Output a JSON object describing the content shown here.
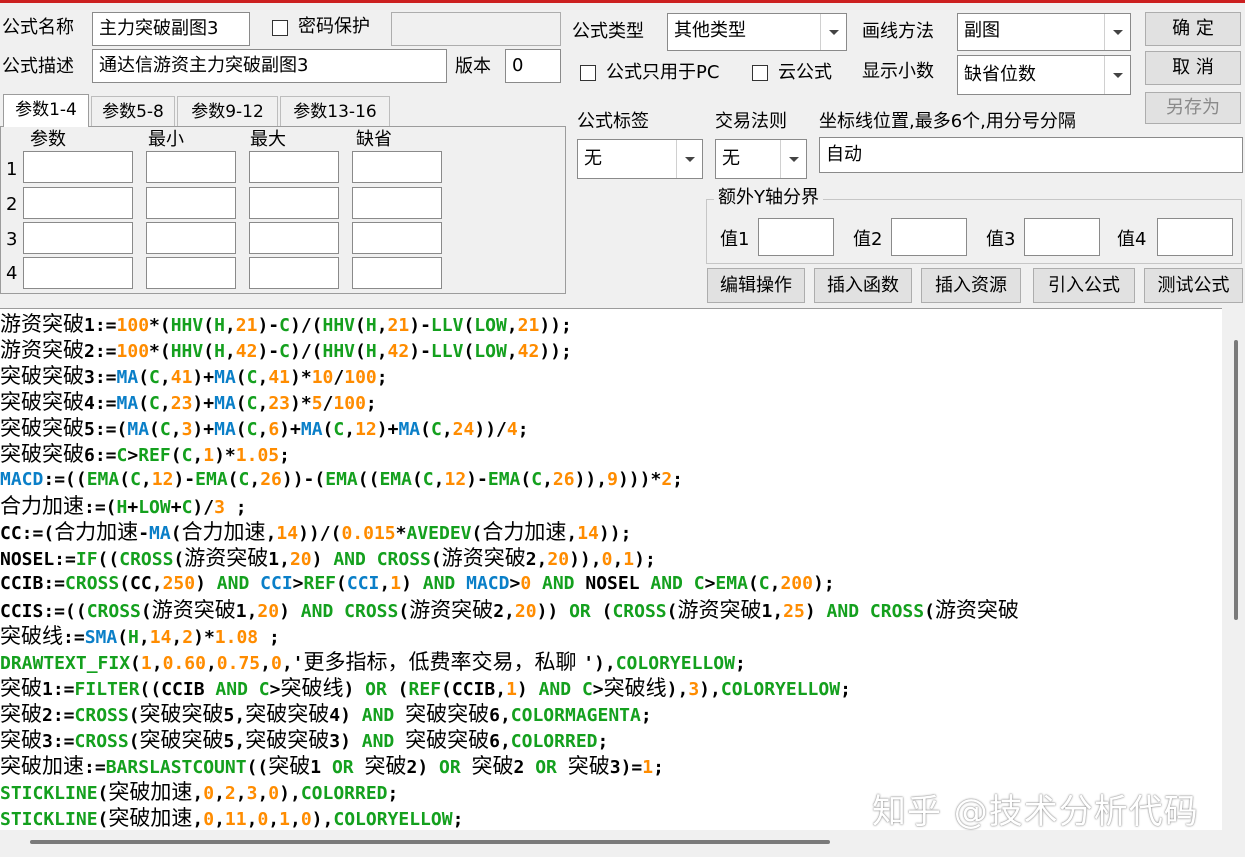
{
  "form": {
    "name_label": "公式名称",
    "name_value": "主力突破副图3",
    "password_label": "密码保护",
    "desc_label": "公式描述",
    "desc_value": "通达信游资主力突破副图3",
    "version_label": "版本",
    "version_value": "0",
    "type_label": "公式类型",
    "type_value": "其他类型",
    "draw_label": "画线方法",
    "draw_value": "副图",
    "pc_only_label": "公式只用于PC",
    "cloud_label": "云公式",
    "decimals_label": "显示小数",
    "decimals_value": "缺省位数",
    "tag_label": "公式标签",
    "tag_value": "无",
    "rule_label": "交易法则",
    "rule_value": "无",
    "axis_label": "坐标线位置,最多6个,用分号分隔",
    "axis_value": "自动"
  },
  "buttons": {
    "ok": "确  定",
    "cancel": "取  消",
    "save_as": "另存为",
    "edit": "编辑操作",
    "insert_func": "插入函数",
    "insert_res": "插入资源",
    "import": "引入公式",
    "test": "测试公式"
  },
  "tabs": [
    "参数1-4",
    "参数5-8",
    "参数9-12",
    "参数13-16"
  ],
  "param_headers": [
    "参数",
    "最小",
    "最大",
    "缺省"
  ],
  "param_rows": [
    "1",
    "2",
    "3",
    "4"
  ],
  "ybound": {
    "title": "额外Y轴分界",
    "v1": "值1",
    "v2": "值2",
    "v3": "值3",
    "v4": "值4"
  },
  "colors": {
    "keyword_blue": "#0a7fc8",
    "func_green": "#14a01e",
    "number_orange": "#ff8c00",
    "title_bar_red": "#cc2020"
  },
  "code_lines": [
    [
      [
        "游资突破",
        "k"
      ],
      [
        "1:=",
        "k"
      ],
      [
        "100",
        "o"
      ],
      [
        "*(",
        "k"
      ],
      [
        "HHV",
        "g"
      ],
      [
        "(",
        "k"
      ],
      [
        "H",
        "g"
      ],
      [
        ",",
        "k"
      ],
      [
        "21",
        "o"
      ],
      [
        ")-",
        "k"
      ],
      [
        "C",
        "g"
      ],
      [
        ")/(",
        "k"
      ],
      [
        "HHV",
        "g"
      ],
      [
        "(",
        "k"
      ],
      [
        "H",
        "g"
      ],
      [
        ",",
        "k"
      ],
      [
        "21",
        "o"
      ],
      [
        ")-",
        "k"
      ],
      [
        "LLV",
        "g"
      ],
      [
        "(",
        "k"
      ],
      [
        "LOW",
        "g"
      ],
      [
        ",",
        "k"
      ],
      [
        "21",
        "o"
      ],
      [
        "));",
        "k"
      ]
    ],
    [
      [
        "游资突破",
        "k"
      ],
      [
        "2:=",
        "k"
      ],
      [
        "100",
        "o"
      ],
      [
        "*(",
        "k"
      ],
      [
        "HHV",
        "g"
      ],
      [
        "(",
        "k"
      ],
      [
        "H",
        "g"
      ],
      [
        ",",
        "k"
      ],
      [
        "42",
        "o"
      ],
      [
        ")-",
        "k"
      ],
      [
        "C",
        "g"
      ],
      [
        ")/(",
        "k"
      ],
      [
        "HHV",
        "g"
      ],
      [
        "(",
        "k"
      ],
      [
        "H",
        "g"
      ],
      [
        ",",
        "k"
      ],
      [
        "42",
        "o"
      ],
      [
        ")-",
        "k"
      ],
      [
        "LLV",
        "g"
      ],
      [
        "(",
        "k"
      ],
      [
        "LOW",
        "g"
      ],
      [
        ",",
        "k"
      ],
      [
        "42",
        "o"
      ],
      [
        "));",
        "k"
      ]
    ],
    [
      [
        "突破突破",
        "k"
      ],
      [
        "3:=",
        "k"
      ],
      [
        "MA",
        "b"
      ],
      [
        "(",
        "k"
      ],
      [
        "C",
        "g"
      ],
      [
        ",",
        "k"
      ],
      [
        "41",
        "o"
      ],
      [
        ")+",
        "k"
      ],
      [
        "MA",
        "b"
      ],
      [
        "(",
        "k"
      ],
      [
        "C",
        "g"
      ],
      [
        ",",
        "k"
      ],
      [
        "41",
        "o"
      ],
      [
        ")*",
        "k"
      ],
      [
        "10",
        "o"
      ],
      [
        "/",
        "k"
      ],
      [
        "100",
        "o"
      ],
      [
        ";",
        "k"
      ]
    ],
    [
      [
        "突破突破",
        "k"
      ],
      [
        "4:=",
        "k"
      ],
      [
        "MA",
        "b"
      ],
      [
        "(",
        "k"
      ],
      [
        "C",
        "g"
      ],
      [
        ",",
        "k"
      ],
      [
        "23",
        "o"
      ],
      [
        ")+",
        "k"
      ],
      [
        "MA",
        "b"
      ],
      [
        "(",
        "k"
      ],
      [
        "C",
        "g"
      ],
      [
        ",",
        "k"
      ],
      [
        "23",
        "o"
      ],
      [
        ")*",
        "k"
      ],
      [
        "5",
        "o"
      ],
      [
        "/",
        "k"
      ],
      [
        "100",
        "o"
      ],
      [
        ";",
        "k"
      ]
    ],
    [
      [
        "突破突破",
        "k"
      ],
      [
        "5:=(",
        "k"
      ],
      [
        "MA",
        "b"
      ],
      [
        "(",
        "k"
      ],
      [
        "C",
        "g"
      ],
      [
        ",",
        "k"
      ],
      [
        "3",
        "o"
      ],
      [
        ")+",
        "k"
      ],
      [
        "MA",
        "b"
      ],
      [
        "(",
        "k"
      ],
      [
        "C",
        "g"
      ],
      [
        ",",
        "k"
      ],
      [
        "6",
        "o"
      ],
      [
        ")+",
        "k"
      ],
      [
        "MA",
        "b"
      ],
      [
        "(",
        "k"
      ],
      [
        "C",
        "g"
      ],
      [
        ",",
        "k"
      ],
      [
        "12",
        "o"
      ],
      [
        ")+",
        "k"
      ],
      [
        "MA",
        "b"
      ],
      [
        "(",
        "k"
      ],
      [
        "C",
        "g"
      ],
      [
        ",",
        "k"
      ],
      [
        "24",
        "o"
      ],
      [
        "))/",
        "k"
      ],
      [
        "4",
        "o"
      ],
      [
        ";",
        "k"
      ]
    ],
    [
      [
        "突破突破",
        "k"
      ],
      [
        "6:=",
        "k"
      ],
      [
        "C",
        "g"
      ],
      [
        ">",
        "k"
      ],
      [
        "REF",
        "g"
      ],
      [
        "(",
        "k"
      ],
      [
        "C",
        "g"
      ],
      [
        ",",
        "k"
      ],
      [
        "1",
        "o"
      ],
      [
        ")*",
        "k"
      ],
      [
        "1.05",
        "o"
      ],
      [
        ";",
        "k"
      ]
    ],
    [
      [
        "MACD",
        "b"
      ],
      [
        ":=((",
        "k"
      ],
      [
        "EMA",
        "g"
      ],
      [
        "(",
        "k"
      ],
      [
        "C",
        "g"
      ],
      [
        ",",
        "k"
      ],
      [
        "12",
        "o"
      ],
      [
        ")-",
        "k"
      ],
      [
        "EMA",
        "g"
      ],
      [
        "(",
        "k"
      ],
      [
        "C",
        "g"
      ],
      [
        ",",
        "k"
      ],
      [
        "26",
        "o"
      ],
      [
        "))-(",
        "k"
      ],
      [
        "EMA",
        "g"
      ],
      [
        "((",
        "k"
      ],
      [
        "EMA",
        "g"
      ],
      [
        "(",
        "k"
      ],
      [
        "C",
        "g"
      ],
      [
        ",",
        "k"
      ],
      [
        "12",
        "o"
      ],
      [
        ")-",
        "k"
      ],
      [
        "EMA",
        "g"
      ],
      [
        "(",
        "k"
      ],
      [
        "C",
        "g"
      ],
      [
        ",",
        "k"
      ],
      [
        "26",
        "o"
      ],
      [
        ")),",
        "k"
      ],
      [
        "9",
        "o"
      ],
      [
        ")))*",
        "k"
      ],
      [
        "2",
        "o"
      ],
      [
        ";",
        "k"
      ]
    ],
    [
      [
        "合力加速",
        "k"
      ],
      [
        ":=(",
        "k"
      ],
      [
        "H",
        "g"
      ],
      [
        "+",
        "k"
      ],
      [
        "LOW",
        "g"
      ],
      [
        "+",
        "k"
      ],
      [
        "C",
        "g"
      ],
      [
        ")/",
        "k"
      ],
      [
        "3",
        "o"
      ],
      [
        " ;",
        "k"
      ]
    ],
    [
      [
        "CC:=(",
        "k"
      ],
      [
        "合力加速",
        "k"
      ],
      [
        "-",
        "k"
      ],
      [
        "MA",
        "b"
      ],
      [
        "(",
        "k"
      ],
      [
        "合力加速",
        "k"
      ],
      [
        ",",
        "k"
      ],
      [
        "14",
        "o"
      ],
      [
        "))/(",
        "k"
      ],
      [
        "0.015",
        "o"
      ],
      [
        "*",
        "k"
      ],
      [
        "AVEDEV",
        "g"
      ],
      [
        "(",
        "k"
      ],
      [
        "合力加速",
        "k"
      ],
      [
        ",",
        "k"
      ],
      [
        "14",
        "o"
      ],
      [
        "));",
        "k"
      ]
    ],
    [
      [
        "NOSEL:=",
        "k"
      ],
      [
        "IF",
        "g"
      ],
      [
        "((",
        "k"
      ],
      [
        "CROSS",
        "g"
      ],
      [
        "(",
        "k"
      ],
      [
        "游资突破",
        "k"
      ],
      [
        "1,",
        "k"
      ],
      [
        "20",
        "o"
      ],
      [
        ") ",
        "k"
      ],
      [
        "AND",
        "g"
      ],
      [
        " ",
        "k"
      ],
      [
        "CROSS",
        "g"
      ],
      [
        "(",
        "k"
      ],
      [
        "游资突破",
        "k"
      ],
      [
        "2,",
        "k"
      ],
      [
        "20",
        "o"
      ],
      [
        ")),",
        "k"
      ],
      [
        "0",
        "o"
      ],
      [
        ",",
        "k"
      ],
      [
        "1",
        "o"
      ],
      [
        ");",
        "k"
      ]
    ],
    [
      [
        "CCIB:=",
        "k"
      ],
      [
        "CROSS",
        "g"
      ],
      [
        "(CC,",
        "k"
      ],
      [
        "250",
        "o"
      ],
      [
        ") ",
        "k"
      ],
      [
        "AND",
        "g"
      ],
      [
        " ",
        "k"
      ],
      [
        "CCI",
        "b"
      ],
      [
        ">",
        "k"
      ],
      [
        "REF",
        "g"
      ],
      [
        "(",
        "k"
      ],
      [
        "CCI",
        "b"
      ],
      [
        ",",
        "k"
      ],
      [
        "1",
        "o"
      ],
      [
        ") ",
        "k"
      ],
      [
        "AND",
        "g"
      ],
      [
        " ",
        "k"
      ],
      [
        "MACD",
        "b"
      ],
      [
        ">",
        "k"
      ],
      [
        "0",
        "o"
      ],
      [
        " ",
        "k"
      ],
      [
        "AND",
        "g"
      ],
      [
        " NOSEL ",
        "k"
      ],
      [
        "AND",
        "g"
      ],
      [
        " ",
        "k"
      ],
      [
        "C",
        "g"
      ],
      [
        ">",
        "k"
      ],
      [
        "EMA",
        "g"
      ],
      [
        "(",
        "k"
      ],
      [
        "C",
        "g"
      ],
      [
        ",",
        "k"
      ],
      [
        "200",
        "o"
      ],
      [
        ");",
        "k"
      ]
    ],
    [
      [
        "CCIS:=((",
        "k"
      ],
      [
        "CROSS",
        "g"
      ],
      [
        "(",
        "k"
      ],
      [
        "游资突破",
        "k"
      ],
      [
        "1,",
        "k"
      ],
      [
        "20",
        "o"
      ],
      [
        ") ",
        "k"
      ],
      [
        "AND",
        "g"
      ],
      [
        " ",
        "k"
      ],
      [
        "CROSS",
        "g"
      ],
      [
        "(",
        "k"
      ],
      [
        "游资突破",
        "k"
      ],
      [
        "2,",
        "k"
      ],
      [
        "20",
        "o"
      ],
      [
        ")) ",
        "k"
      ],
      [
        "OR",
        "g"
      ],
      [
        " (",
        "k"
      ],
      [
        "CROSS",
        "g"
      ],
      [
        "(",
        "k"
      ],
      [
        "游资突破",
        "k"
      ],
      [
        "1,",
        "k"
      ],
      [
        "25",
        "o"
      ],
      [
        ") ",
        "k"
      ],
      [
        "AND",
        "g"
      ],
      [
        " ",
        "k"
      ],
      [
        "CROSS",
        "g"
      ],
      [
        "(",
        "k"
      ],
      [
        "游资突破",
        "k"
      ]
    ],
    [
      [
        "突破线",
        "k"
      ],
      [
        ":=",
        "k"
      ],
      [
        "SMA",
        "b"
      ],
      [
        "(",
        "k"
      ],
      [
        "H",
        "g"
      ],
      [
        ",",
        "k"
      ],
      [
        "14",
        "o"
      ],
      [
        ",",
        "k"
      ],
      [
        "2",
        "o"
      ],
      [
        ")*",
        "k"
      ],
      [
        "1.08",
        "o"
      ],
      [
        " ;",
        "k"
      ]
    ],
    [
      [
        "DRAWTEXT_FIX",
        "g"
      ],
      [
        "(",
        "k"
      ],
      [
        "1",
        "o"
      ],
      [
        ",",
        "k"
      ],
      [
        "0.60",
        "o"
      ],
      [
        ",",
        "k"
      ],
      [
        "0.75",
        "o"
      ],
      [
        ",",
        "k"
      ],
      [
        "0",
        "o"
      ],
      [
        ",'",
        "k"
      ],
      [
        "更多指标，低费率交易，私聊 ",
        "k"
      ],
      [
        "'),",
        "k"
      ],
      [
        "COLORYELLOW",
        "g"
      ],
      [
        ";",
        "k"
      ]
    ],
    [
      [
        "突破",
        "k"
      ],
      [
        "1:=",
        "k"
      ],
      [
        "FILTER",
        "g"
      ],
      [
        "((CCIB ",
        "k"
      ],
      [
        "AND",
        "g"
      ],
      [
        " ",
        "k"
      ],
      [
        "C",
        "g"
      ],
      [
        ">",
        "k"
      ],
      [
        "突破线",
        "k"
      ],
      [
        ") ",
        "k"
      ],
      [
        "OR",
        "g"
      ],
      [
        " (",
        "k"
      ],
      [
        "REF",
        "g"
      ],
      [
        "(CCIB,",
        "k"
      ],
      [
        "1",
        "o"
      ],
      [
        ") ",
        "k"
      ],
      [
        "AND",
        "g"
      ],
      [
        " ",
        "k"
      ],
      [
        "C",
        "g"
      ],
      [
        ">",
        "k"
      ],
      [
        "突破线",
        "k"
      ],
      [
        "),",
        "k"
      ],
      [
        "3",
        "o"
      ],
      [
        "),",
        "k"
      ],
      [
        "COLORYELLOW",
        "g"
      ],
      [
        ";",
        "k"
      ]
    ],
    [
      [
        "突破",
        "k"
      ],
      [
        "2:=",
        "k"
      ],
      [
        "CROSS",
        "g"
      ],
      [
        "(",
        "k"
      ],
      [
        "突破突破",
        "k"
      ],
      [
        "5,",
        "k"
      ],
      [
        "突破突破",
        "k"
      ],
      [
        "4) ",
        "k"
      ],
      [
        "AND",
        "g"
      ],
      [
        " ",
        "k"
      ],
      [
        "突破突破",
        "k"
      ],
      [
        "6,",
        "k"
      ],
      [
        "COLORMAGENTA",
        "g"
      ],
      [
        ";",
        "k"
      ]
    ],
    [
      [
        "突破",
        "k"
      ],
      [
        "3:=",
        "k"
      ],
      [
        "CROSS",
        "g"
      ],
      [
        "(",
        "k"
      ],
      [
        "突破突破",
        "k"
      ],
      [
        "5,",
        "k"
      ],
      [
        "突破突破",
        "k"
      ],
      [
        "3) ",
        "k"
      ],
      [
        "AND",
        "g"
      ],
      [
        " ",
        "k"
      ],
      [
        "突破突破",
        "k"
      ],
      [
        "6,",
        "k"
      ],
      [
        "COLORRED",
        "g"
      ],
      [
        ";",
        "k"
      ]
    ],
    [
      [
        "突破加速",
        "k"
      ],
      [
        ":=",
        "k"
      ],
      [
        "BARSLASTCOUNT",
        "g"
      ],
      [
        "((",
        "k"
      ],
      [
        "突破",
        "k"
      ],
      [
        "1 ",
        "k"
      ],
      [
        "OR",
        "g"
      ],
      [
        " ",
        "k"
      ],
      [
        "突破",
        "k"
      ],
      [
        "2) ",
        "k"
      ],
      [
        "OR",
        "g"
      ],
      [
        " ",
        "k"
      ],
      [
        "突破",
        "k"
      ],
      [
        "2 ",
        "k"
      ],
      [
        "OR",
        "g"
      ],
      [
        " ",
        "k"
      ],
      [
        "突破",
        "k"
      ],
      [
        "3)=",
        "k"
      ],
      [
        "1",
        "o"
      ],
      [
        ";",
        "k"
      ]
    ],
    [
      [
        "STICKLINE",
        "g"
      ],
      [
        "(",
        "k"
      ],
      [
        "突破加速",
        "k"
      ],
      [
        ",",
        "k"
      ],
      [
        "0",
        "o"
      ],
      [
        ",",
        "k"
      ],
      [
        "2",
        "o"
      ],
      [
        ",",
        "k"
      ],
      [
        "3",
        "o"
      ],
      [
        ",",
        "k"
      ],
      [
        "0",
        "o"
      ],
      [
        "),",
        "k"
      ],
      [
        "COLORRED",
        "g"
      ],
      [
        ";",
        "k"
      ]
    ],
    [
      [
        "STICKLINE",
        "g"
      ],
      [
        "(",
        "k"
      ],
      [
        "突破加速",
        "k"
      ],
      [
        ",",
        "k"
      ],
      [
        "0",
        "o"
      ],
      [
        ",",
        "k"
      ],
      [
        "11",
        "o"
      ],
      [
        ",",
        "k"
      ],
      [
        "0",
        "o"
      ],
      [
        ",",
        "k"
      ],
      [
        "1",
        "o"
      ],
      [
        ",",
        "k"
      ],
      [
        "0",
        "o"
      ],
      [
        "),",
        "k"
      ],
      [
        "COLORYELLOW",
        "g"
      ],
      [
        ";",
        "k"
      ]
    ]
  ],
  "watermark": "知乎 @技术分析代码"
}
